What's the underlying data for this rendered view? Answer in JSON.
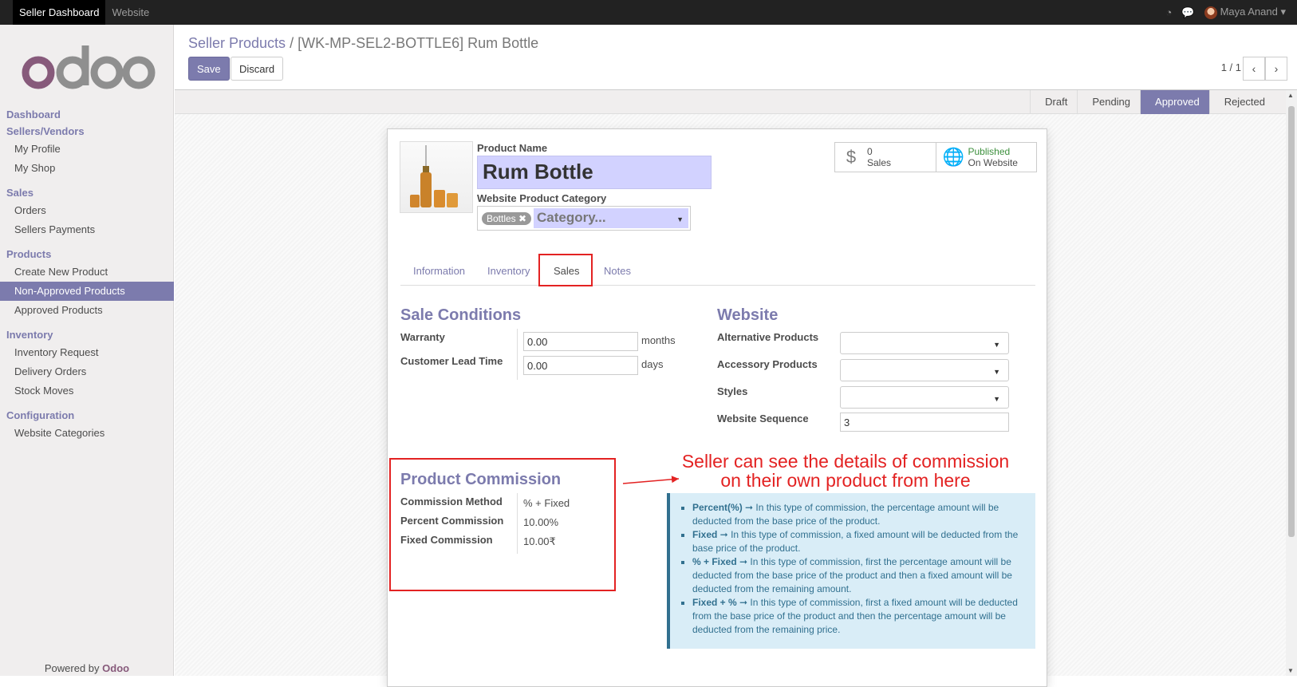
{
  "topbar": {
    "tabs": [
      "Seller Dashboard",
      "Website"
    ],
    "user": "Maya Anand"
  },
  "sidebar": {
    "sections": [
      {
        "header": "Dashboard",
        "items": []
      },
      {
        "header": "Sellers/Vendors",
        "items": [
          "My Profile",
          "My Shop"
        ]
      },
      {
        "header": "Sales",
        "items": [
          "Orders",
          "Sellers Payments"
        ]
      },
      {
        "header": "Products",
        "items": [
          "Create New Product",
          "Non-Approved Products",
          "Approved Products"
        ]
      },
      {
        "header": "Inventory",
        "items": [
          "Inventory Request",
          "Delivery Orders",
          "Stock Moves"
        ]
      },
      {
        "header": "Configuration",
        "items": [
          "Website Categories"
        ]
      }
    ],
    "active_item": "Non-Approved Products",
    "powered_prefix": "Powered by",
    "powered_brand": "Odoo"
  },
  "control_panel": {
    "breadcrumb_parent": "Seller Products",
    "breadcrumb_sep": "/",
    "breadcrumb_current": "[WK-MP-SEL2-BOTTLE6] Rum Bottle",
    "save_label": "Save",
    "discard_label": "Discard",
    "pager": "1 / 1"
  },
  "status": {
    "stages": [
      "Draft",
      "Pending",
      "Approved",
      "Rejected"
    ],
    "current": "Approved"
  },
  "form": {
    "product_name_label": "Product Name",
    "product_name": "Rum Bottle",
    "category_label": "Website Product Category",
    "category_tag": "Bottles",
    "category_placeholder": "Category...",
    "smart_sales_count": "0",
    "smart_sales_label": "Sales",
    "smart_published": "Published",
    "smart_on_website": "On Website",
    "tabs": [
      "Information",
      "Inventory",
      "Sales",
      "Notes"
    ],
    "active_tab": "Sales"
  },
  "sale_conditions": {
    "title": "Sale Conditions",
    "warranty_label": "Warranty",
    "warranty_value": "0.00",
    "warranty_unit": "months",
    "lead_label": "Customer Lead Time",
    "lead_value": "0.00",
    "lead_unit": "days"
  },
  "website": {
    "title": "Website",
    "alt_label": "Alternative Products",
    "acc_label": "Accessory Products",
    "styles_label": "Styles",
    "seq_label": "Website Sequence",
    "seq_value": "3"
  },
  "commission": {
    "title": "Product Commission",
    "method_label": "Commission Method",
    "method_value": "% + Fixed",
    "percent_label": "Percent Commission",
    "percent_value": "10.00%",
    "fixed_label": "Fixed Commission",
    "fixed_value": "10.00₹"
  },
  "info": [
    {
      "term": "Percent(%)",
      "text": " ➞ In this type of commission, the percentage amount will be deducted from the base price of the product."
    },
    {
      "term": "Fixed",
      "text": " ➞ In this type of commission, a fixed amount will be deducted from the base price of the product."
    },
    {
      "term": "% + Fixed",
      "text": " ➞ In this type of commission, first the percentage amount will be deducted from the base price of the product and then a fixed amount will be deducted from the remaining amount."
    },
    {
      "term": "Fixed + %",
      "text": " ➞ In this type of commission, first a fixed amount will be deducted from the base price of the product and then the percentage amount will be deducted from the remaining price."
    }
  ],
  "annotation": {
    "line1": "Seller can see the details of commission",
    "line2": "on their own product from here",
    "color": "#e32222"
  },
  "colors": {
    "brand": "#7c7bad",
    "odoo_purple": "#875a7b",
    "info_bg": "#d9edf7"
  }
}
